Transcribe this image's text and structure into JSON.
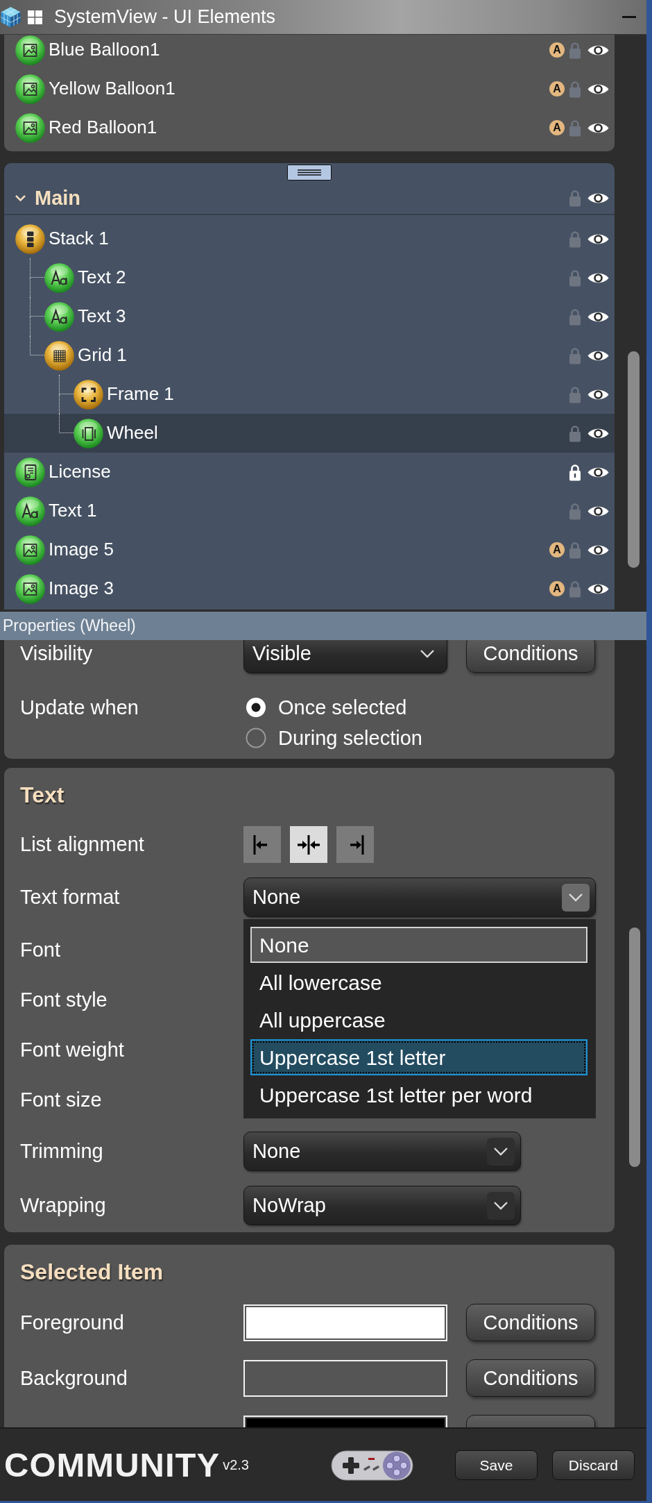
{
  "window": {
    "title": "SystemView - UI Elements"
  },
  "layers": {
    "items": [
      {
        "name": "Blue Balloon1",
        "kind": "image",
        "badge": "A",
        "locked": false,
        "visible": true,
        "selected": false
      },
      {
        "name": "Yellow Balloon1",
        "kind": "image",
        "badge": "A",
        "locked": false,
        "visible": true,
        "selected": false
      },
      {
        "name": "Red Balloon1",
        "kind": "image",
        "badge": "A",
        "locked": false,
        "visible": true,
        "selected": false
      }
    ]
  },
  "main_group": {
    "title": "Main",
    "expanded": true,
    "locked": false,
    "visible": true,
    "items": [
      {
        "name": "Stack 1",
        "kind": "stack",
        "locked": false,
        "visible": true,
        "selected": false,
        "children": [
          {
            "name": "Text 2",
            "kind": "text",
            "locked": false,
            "visible": true,
            "selected": false
          },
          {
            "name": "Text 3",
            "kind": "text",
            "locked": false,
            "visible": true,
            "selected": false
          },
          {
            "name": "Grid 1",
            "kind": "grid",
            "locked": false,
            "visible": true,
            "selected": false,
            "children": [
              {
                "name": "Frame 1",
                "kind": "frame",
                "locked": false,
                "visible": true,
                "selected": false
              },
              {
                "name": "Wheel",
                "kind": "wheel",
                "locked": false,
                "visible": true,
                "selected": true
              }
            ]
          }
        ]
      },
      {
        "name": "License",
        "kind": "license",
        "locked": true,
        "visible": true,
        "selected": false
      },
      {
        "name": "Text 1",
        "kind": "text",
        "locked": false,
        "visible": true,
        "selected": false
      },
      {
        "name": "Image 5",
        "kind": "image",
        "badge": "A",
        "locked": false,
        "visible": true,
        "selected": false
      },
      {
        "name": "Image 3",
        "kind": "image",
        "badge": "A",
        "locked": false,
        "visible": true,
        "selected": false
      }
    ]
  },
  "properties": {
    "title": "Properties (Wheel)",
    "sections": [
      {
        "rows": [
          {
            "kind": "dropdown",
            "label": "Visibility",
            "value": "Visible",
            "open": false,
            "button": "Conditions"
          },
          {
            "kind": "radio",
            "label": "Update when",
            "options": [
              {
                "label": "Once selected",
                "selected": true
              },
              {
                "label": "During selection",
                "selected": false
              }
            ]
          }
        ]
      },
      {
        "title": "Text",
        "rows": [
          {
            "kind": "alignment",
            "label": "List alignment",
            "options": [
              {
                "kind": "left",
                "selected": false
              },
              {
                "kind": "center",
                "selected": true
              },
              {
                "kind": "right",
                "selected": false
              }
            ]
          },
          {
            "kind": "dropdown",
            "label": "Text format",
            "value": "None",
            "open": true,
            "options": [
              {
                "label": "None",
                "selected": true,
                "highlighted": false
              },
              {
                "label": "All lowercase",
                "selected": false,
                "highlighted": false
              },
              {
                "label": "All uppercase",
                "selected": false,
                "highlighted": false
              },
              {
                "label": "Uppercase 1st letter",
                "selected": false,
                "highlighted": true
              },
              {
                "label": "Uppercase 1st letter per word",
                "selected": false,
                "highlighted": false
              }
            ]
          },
          {
            "kind": "covered",
            "label": "Font"
          },
          {
            "kind": "covered",
            "label": "Font style"
          },
          {
            "kind": "covered",
            "label": "Font weight"
          },
          {
            "kind": "covered",
            "label": "Font size"
          },
          {
            "kind": "dropdown",
            "label": "Trimming",
            "value": "None",
            "open": false
          },
          {
            "kind": "dropdown",
            "label": "Wrapping",
            "value": "NoWrap",
            "open": false
          }
        ]
      },
      {
        "title": "Selected Item",
        "rows": [
          {
            "kind": "color",
            "label": "Foreground",
            "color": "#ffffff",
            "button": "Conditions"
          },
          {
            "kind": "color",
            "label": "Background",
            "color": "#555555",
            "button": "Conditions"
          },
          {
            "kind": "color",
            "color": "#000000"
          }
        ]
      }
    ]
  },
  "footer": {
    "logo": "COMMUNITY",
    "version": "v2.3",
    "buttons": [
      "Save",
      "Discard"
    ]
  }
}
